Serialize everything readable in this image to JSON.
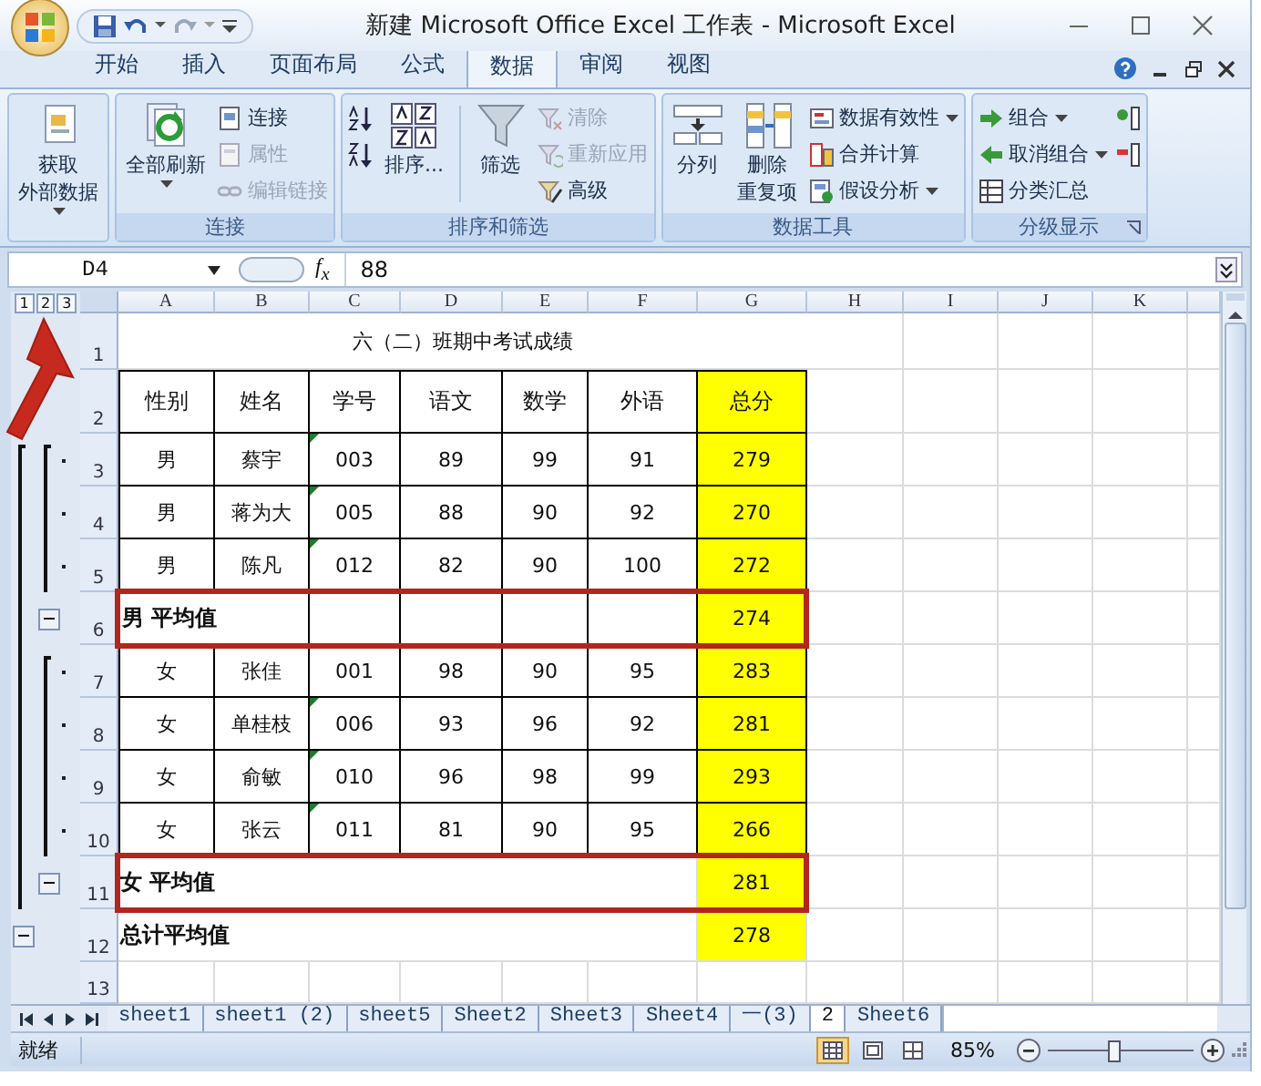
{
  "window": {
    "title": "新建 Microsoft Office Excel 工作表 - Microsoft Excel"
  },
  "tabs": [
    {
      "label": "开始",
      "selected": false
    },
    {
      "label": "插入",
      "selected": false
    },
    {
      "label": "页面布局",
      "selected": false
    },
    {
      "label": "公式",
      "selected": false
    },
    {
      "label": "数据",
      "selected": true
    },
    {
      "label": "审阅",
      "selected": false
    },
    {
      "label": "视图",
      "selected": false
    }
  ],
  "ribbon": {
    "groups": [
      {
        "columns": [
          {
            "kind": "large",
            "lines": [
              "获取",
              "外部数据"
            ],
            "dropdown": true
          }
        ]
      },
      {
        "label": "连接",
        "columns": [
          {
            "kind": "large",
            "lines": [
              "全部刷新"
            ],
            "dropdown": true
          },
          {
            "kind": "stack",
            "items": [
              {
                "text": "连接",
                "disabled": false
              },
              {
                "text": "属性",
                "disabled": true
              },
              {
                "text": "编辑链接",
                "disabled": true
              }
            ]
          }
        ]
      },
      {
        "label": "排序和筛选",
        "columns": [
          {
            "kind": "icons",
            "items": [
              {
                "disabled": false
              },
              {
                "disabled": false
              }
            ]
          },
          {
            "kind": "large",
            "lines": [
              "排序..."
            ]
          },
          {
            "kind": "separator"
          },
          {
            "kind": "large",
            "lines": [
              "筛选"
            ]
          },
          {
            "kind": "stack",
            "items": [
              {
                "text": "清除",
                "disabled": true
              },
              {
                "text": "重新应用",
                "disabled": true
              },
              {
                "text": "高级",
                "disabled": false
              }
            ]
          }
        ]
      },
      {
        "label": "数据工具",
        "columns": [
          {
            "kind": "large",
            "lines": [
              "分列"
            ]
          },
          {
            "kind": "large",
            "lines": [
              "删除",
              "重复项"
            ]
          },
          {
            "kind": "stack",
            "items": [
              {
                "text": "数据有效性",
                "disabled": false,
                "dropdown": true
              },
              {
                "text": "合并计算",
                "disabled": false
              },
              {
                "text": "假设分析",
                "disabled": false,
                "dropdown": true
              }
            ]
          }
        ]
      },
      {
        "label": "分级显示",
        "launcher": true,
        "columns": [
          {
            "kind": "stack",
            "items": [
              {
                "text": "组合",
                "disabled": false,
                "dropdown": true
              },
              {
                "text": "取消组合",
                "disabled": false,
                "dropdown": true
              },
              {
                "text": "分类汇总",
                "disabled": false
              }
            ]
          },
          {
            "kind": "icons",
            "items": [
              {
                "disabled": false
              },
              {
                "disabled": false
              }
            ]
          }
        ]
      }
    ]
  },
  "formula_bar": {
    "name_box": "D4",
    "function_button": "f$_{x}$",
    "formula": "88"
  },
  "outline_levels": [
    "1",
    "2",
    "3"
  ],
  "columns": [
    "A",
    "B",
    "C",
    "D",
    "E",
    "F",
    "G",
    "H",
    "I",
    "J",
    "K"
  ],
  "rows": [
    {
      "number": "1",
      "kind": "title",
      "text": "六（二）班期中考试成绩"
    },
    {
      "number": "2",
      "kind": "header",
      "cells": [
        "性别",
        "姓名",
        "学号",
        "语文",
        "数学",
        "外语",
        "总分"
      ]
    },
    {
      "number": "3",
      "kind": "record",
      "flag": true,
      "outline": {
        "kind": "detail"
      },
      "cells": [
        "男",
        "蔡宇",
        "003",
        "89",
        "99",
        "91",
        "279"
      ]
    },
    {
      "number": "4",
      "kind": "record",
      "flag": true,
      "outline": {
        "kind": "detail"
      },
      "cells": [
        "男",
        "蒋为大",
        "005",
        "88",
        "90",
        "92",
        "270"
      ]
    },
    {
      "number": "5",
      "kind": "record",
      "flag": true,
      "outline": {
        "kind": "detail"
      },
      "cells": [
        "男",
        "陈凡",
        "012",
        "82",
        "90",
        "100",
        "272"
      ]
    },
    {
      "number": "6",
      "kind": "subtotal",
      "bordered": true,
      "framed": true,
      "outline": {
        "kind": "subtotal",
        "expanded": true
      },
      "label": "男  平均值",
      "total": "274"
    },
    {
      "number": "7",
      "kind": "record",
      "flag": false,
      "outline": {
        "kind": "detail"
      },
      "cells": [
        "女",
        "张佳",
        "001",
        "98",
        "90",
        "95",
        "283"
      ]
    },
    {
      "number": "8",
      "kind": "record",
      "flag": true,
      "outline": {
        "kind": "detail"
      },
      "cells": [
        "女",
        "单桂枝",
        "006",
        "93",
        "96",
        "92",
        "281"
      ]
    },
    {
      "number": "9",
      "kind": "record",
      "flag": true,
      "outline": {
        "kind": "detail"
      },
      "cells": [
        "女",
        "俞敏",
        "010",
        "96",
        "98",
        "99",
        "293"
      ]
    },
    {
      "number": "10",
      "kind": "record",
      "flag": true,
      "outline": {
        "kind": "detail"
      },
      "cells": [
        "女",
        "张云",
        "011",
        "81",
        "90",
        "95",
        "266"
      ]
    },
    {
      "number": "11",
      "kind": "subtotal",
      "bordered": false,
      "framed": true,
      "outline": {
        "kind": "subtotal",
        "expanded": true
      },
      "label": "女  平均值",
      "total": "281"
    },
    {
      "number": "12",
      "kind": "subtotal",
      "bordered": false,
      "framed": false,
      "outline": {
        "kind": "total",
        "expanded": true
      },
      "label": "总计平均值",
      "total": "278"
    },
    {
      "number": "13",
      "kind": "blank"
    }
  ],
  "sheet_tabs": [
    {
      "label": "sheet1",
      "selected": false
    },
    {
      "label": "sheet1 (2)",
      "selected": false
    },
    {
      "label": "sheet5",
      "selected": false
    },
    {
      "label": "Sheet2",
      "selected": false
    },
    {
      "label": "Sheet3",
      "selected": false
    },
    {
      "label": "Sheet4",
      "selected": false
    },
    {
      "label": "一(3)",
      "selected": false
    },
    {
      "label": "2",
      "selected": true
    },
    {
      "label": "Sheet6",
      "selected": false
    }
  ],
  "status_bar": {
    "text": "就绪",
    "views": [
      {
        "selected": true
      },
      {
        "selected": false
      },
      {
        "selected": false
      }
    ],
    "zoom": "85%",
    "zoom_slider": {
      "level": 0.45
    }
  }
}
